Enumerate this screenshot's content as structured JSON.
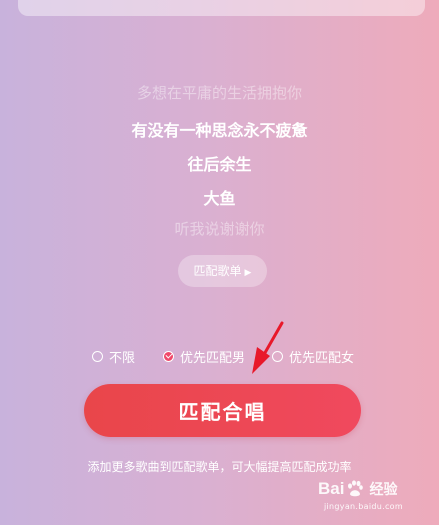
{
  "songs": [
    {
      "title": "多想在平庸的生活拥抱你",
      "state": "faded"
    },
    {
      "title": "有没有一种思念永不疲惫",
      "state": "active"
    },
    {
      "title": "往后余生",
      "state": "active"
    },
    {
      "title": "大鱼",
      "state": "active"
    },
    {
      "title": "听我说谢谢你",
      "state": "faded"
    }
  ],
  "songlist_button": {
    "label": "匹配歌单",
    "icon": "play-triangle-icon"
  },
  "options": [
    {
      "label": "不限",
      "checked": false
    },
    {
      "label": "优先匹配男",
      "checked": true
    },
    {
      "label": "优先匹配女",
      "checked": false
    }
  ],
  "match_button": {
    "label": "匹配合唱",
    "color": "#ec4753"
  },
  "tip": "添加更多歌曲到匹配歌单，可大幅提高匹配成功率",
  "annotation": {
    "icon": "red-arrow-icon",
    "color": "#e8182a"
  },
  "watermark": {
    "brand_left": "Bai",
    "brand_right": "经验",
    "url": "jingyan.baidu.com",
    "icon": "baidu-paw-icon"
  }
}
